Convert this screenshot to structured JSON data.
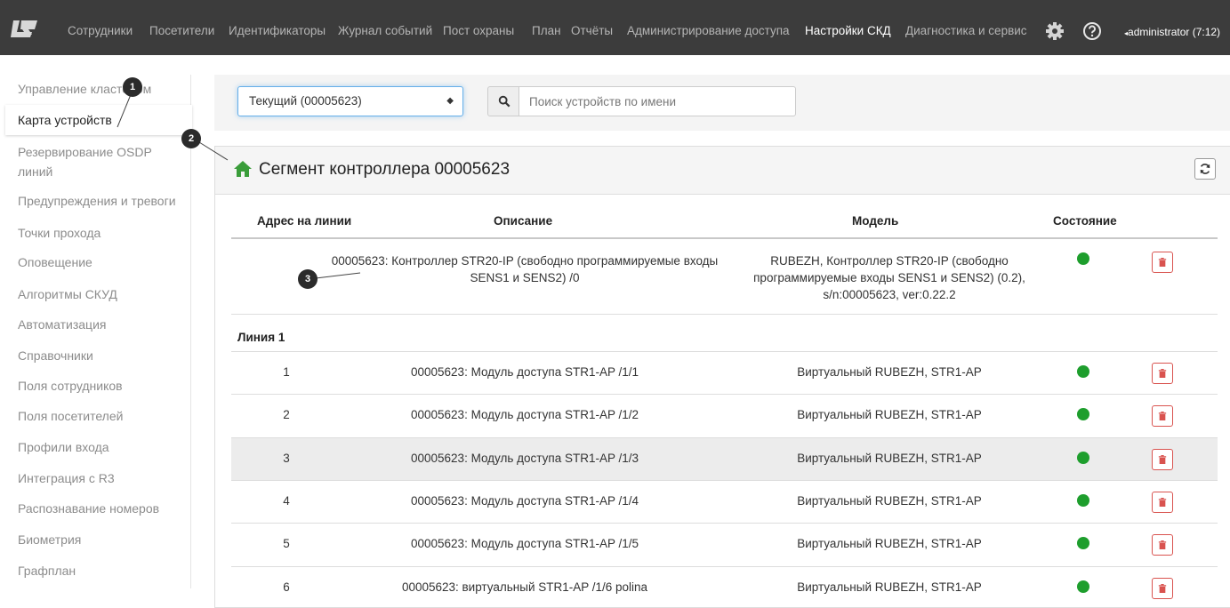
{
  "navbar": {
    "items": [
      "Сотрудники",
      "Посетители",
      "Идентификаторы",
      "Журнал событий",
      "Пост охраны",
      "План",
      "Отчёты",
      "Администрирование доступа",
      "Настройки СКД",
      "Диагностика и сервис"
    ],
    "active_item": "Настройки СКД",
    "settings_icon": "gear-icon",
    "help_icon": "question-circle-icon",
    "user": "administrator (7:12)"
  },
  "sidebar": {
    "items": [
      "Управление кластером",
      "Карта устройств",
      "Резервирование OSDP линий",
      "Предупреждения и тревоги",
      "Точки прохода",
      "Оповещение",
      "Алгоритмы СКУД",
      "Автоматизация",
      "Справочники",
      "Поля сотрудников",
      "Поля посетителей",
      "Профили входа",
      "Интеграция с R3",
      "Распознавание номеров",
      "Биометрия",
      "Графплан"
    ],
    "active_item": "Карта устройств"
  },
  "filter": {
    "selected": "Текущий (00005623)",
    "search_placeholder": "Поиск устройств по имени"
  },
  "panel": {
    "title": "Сегмент контроллера 00005623",
    "columns": [
      "Адрес на линии",
      "Описание",
      "Модель",
      "Состояние"
    ],
    "controller_row": {
      "address": "",
      "description": "00005623: Контроллер STR20-IP (свободно программируемые входы SENS1 и SENS2) /0",
      "model": "RUBEZH, Контроллер STR20-IP (свободно программируемые входы SENS1 и SENS2) (0.2), s/n:00005623, ver:0.22.2",
      "status": "online"
    },
    "group_label": "Линия 1",
    "rows": [
      {
        "address": "1",
        "description": "00005623: Модуль доступа STR1-AP /1/1",
        "model": "Виртуальный RUBEZH, STR1-AP",
        "status": "online"
      },
      {
        "address": "2",
        "description": "00005623: Модуль доступа STR1-AP /1/2",
        "model": "Виртуальный RUBEZH, STR1-AP",
        "status": "online"
      },
      {
        "address": "3",
        "description": "00005623: Модуль доступа STR1-AP /1/3",
        "model": "Виртуальный RUBEZH, STR1-AP",
        "status": "online"
      },
      {
        "address": "4",
        "description": "00005623: Модуль доступа STR1-AP /1/4",
        "model": "Виртуальный RUBEZH, STR1-AP",
        "status": "online"
      },
      {
        "address": "5",
        "description": "00005623: Модуль доступа STR1-AP /1/5",
        "model": "Виртуальный RUBEZH, STR1-AP",
        "status": "online"
      },
      {
        "address": "6",
        "description": "00005623: виртуальный STR1-AP /1/6 polina",
        "model": "Виртуальный RUBEZH, STR1-AP",
        "status": "online"
      }
    ],
    "highlighted_row": 3
  },
  "callouts": [
    "1",
    "2",
    "3"
  ],
  "colors": {
    "navbar_bg": "#3c3c3c",
    "status_online": "#1e9e2d",
    "delete_red": "#d9534f",
    "home_green": "#3a9d3a"
  }
}
